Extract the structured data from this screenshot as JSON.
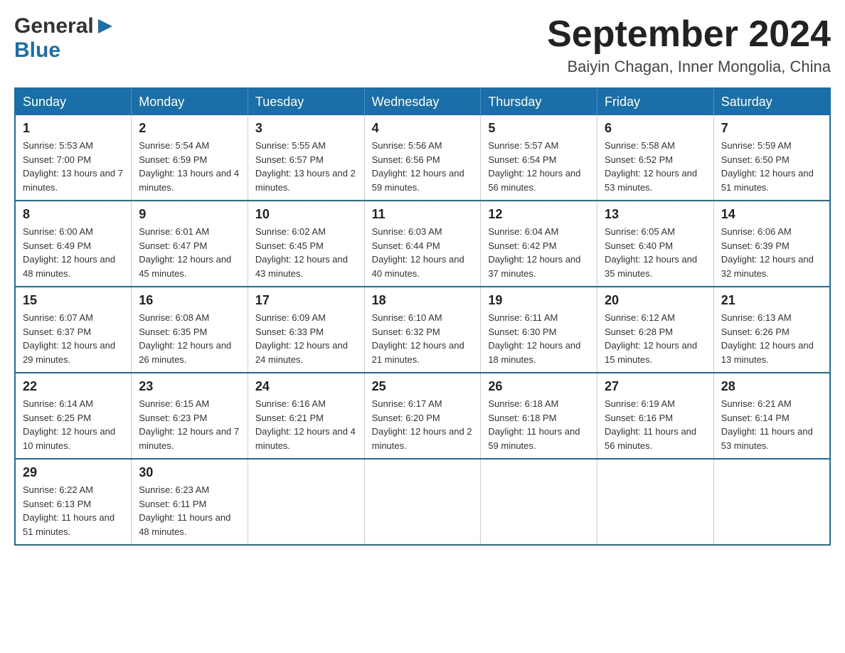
{
  "header": {
    "logo_general": "General",
    "logo_blue": "Blue",
    "month_title": "September 2024",
    "location": "Baiyin Chagan, Inner Mongolia, China"
  },
  "weekdays": [
    "Sunday",
    "Monday",
    "Tuesday",
    "Wednesday",
    "Thursday",
    "Friday",
    "Saturday"
  ],
  "weeks": [
    [
      {
        "day": "1",
        "sunrise": "Sunrise: 5:53 AM",
        "sunset": "Sunset: 7:00 PM",
        "daylight": "Daylight: 13 hours and 7 minutes."
      },
      {
        "day": "2",
        "sunrise": "Sunrise: 5:54 AM",
        "sunset": "Sunset: 6:59 PM",
        "daylight": "Daylight: 13 hours and 4 minutes."
      },
      {
        "day": "3",
        "sunrise": "Sunrise: 5:55 AM",
        "sunset": "Sunset: 6:57 PM",
        "daylight": "Daylight: 13 hours and 2 minutes."
      },
      {
        "day": "4",
        "sunrise": "Sunrise: 5:56 AM",
        "sunset": "Sunset: 6:56 PM",
        "daylight": "Daylight: 12 hours and 59 minutes."
      },
      {
        "day": "5",
        "sunrise": "Sunrise: 5:57 AM",
        "sunset": "Sunset: 6:54 PM",
        "daylight": "Daylight: 12 hours and 56 minutes."
      },
      {
        "day": "6",
        "sunrise": "Sunrise: 5:58 AM",
        "sunset": "Sunset: 6:52 PM",
        "daylight": "Daylight: 12 hours and 53 minutes."
      },
      {
        "day": "7",
        "sunrise": "Sunrise: 5:59 AM",
        "sunset": "Sunset: 6:50 PM",
        "daylight": "Daylight: 12 hours and 51 minutes."
      }
    ],
    [
      {
        "day": "8",
        "sunrise": "Sunrise: 6:00 AM",
        "sunset": "Sunset: 6:49 PM",
        "daylight": "Daylight: 12 hours and 48 minutes."
      },
      {
        "day": "9",
        "sunrise": "Sunrise: 6:01 AM",
        "sunset": "Sunset: 6:47 PM",
        "daylight": "Daylight: 12 hours and 45 minutes."
      },
      {
        "day": "10",
        "sunrise": "Sunrise: 6:02 AM",
        "sunset": "Sunset: 6:45 PM",
        "daylight": "Daylight: 12 hours and 43 minutes."
      },
      {
        "day": "11",
        "sunrise": "Sunrise: 6:03 AM",
        "sunset": "Sunset: 6:44 PM",
        "daylight": "Daylight: 12 hours and 40 minutes."
      },
      {
        "day": "12",
        "sunrise": "Sunrise: 6:04 AM",
        "sunset": "Sunset: 6:42 PM",
        "daylight": "Daylight: 12 hours and 37 minutes."
      },
      {
        "day": "13",
        "sunrise": "Sunrise: 6:05 AM",
        "sunset": "Sunset: 6:40 PM",
        "daylight": "Daylight: 12 hours and 35 minutes."
      },
      {
        "day": "14",
        "sunrise": "Sunrise: 6:06 AM",
        "sunset": "Sunset: 6:39 PM",
        "daylight": "Daylight: 12 hours and 32 minutes."
      }
    ],
    [
      {
        "day": "15",
        "sunrise": "Sunrise: 6:07 AM",
        "sunset": "Sunset: 6:37 PM",
        "daylight": "Daylight: 12 hours and 29 minutes."
      },
      {
        "day": "16",
        "sunrise": "Sunrise: 6:08 AM",
        "sunset": "Sunset: 6:35 PM",
        "daylight": "Daylight: 12 hours and 26 minutes."
      },
      {
        "day": "17",
        "sunrise": "Sunrise: 6:09 AM",
        "sunset": "Sunset: 6:33 PM",
        "daylight": "Daylight: 12 hours and 24 minutes."
      },
      {
        "day": "18",
        "sunrise": "Sunrise: 6:10 AM",
        "sunset": "Sunset: 6:32 PM",
        "daylight": "Daylight: 12 hours and 21 minutes."
      },
      {
        "day": "19",
        "sunrise": "Sunrise: 6:11 AM",
        "sunset": "Sunset: 6:30 PM",
        "daylight": "Daylight: 12 hours and 18 minutes."
      },
      {
        "day": "20",
        "sunrise": "Sunrise: 6:12 AM",
        "sunset": "Sunset: 6:28 PM",
        "daylight": "Daylight: 12 hours and 15 minutes."
      },
      {
        "day": "21",
        "sunrise": "Sunrise: 6:13 AM",
        "sunset": "Sunset: 6:26 PM",
        "daylight": "Daylight: 12 hours and 13 minutes."
      }
    ],
    [
      {
        "day": "22",
        "sunrise": "Sunrise: 6:14 AM",
        "sunset": "Sunset: 6:25 PM",
        "daylight": "Daylight: 12 hours and 10 minutes."
      },
      {
        "day": "23",
        "sunrise": "Sunrise: 6:15 AM",
        "sunset": "Sunset: 6:23 PM",
        "daylight": "Daylight: 12 hours and 7 minutes."
      },
      {
        "day": "24",
        "sunrise": "Sunrise: 6:16 AM",
        "sunset": "Sunset: 6:21 PM",
        "daylight": "Daylight: 12 hours and 4 minutes."
      },
      {
        "day": "25",
        "sunrise": "Sunrise: 6:17 AM",
        "sunset": "Sunset: 6:20 PM",
        "daylight": "Daylight: 12 hours and 2 minutes."
      },
      {
        "day": "26",
        "sunrise": "Sunrise: 6:18 AM",
        "sunset": "Sunset: 6:18 PM",
        "daylight": "Daylight: 11 hours and 59 minutes."
      },
      {
        "day": "27",
        "sunrise": "Sunrise: 6:19 AM",
        "sunset": "Sunset: 6:16 PM",
        "daylight": "Daylight: 11 hours and 56 minutes."
      },
      {
        "day": "28",
        "sunrise": "Sunrise: 6:21 AM",
        "sunset": "Sunset: 6:14 PM",
        "daylight": "Daylight: 11 hours and 53 minutes."
      }
    ],
    [
      {
        "day": "29",
        "sunrise": "Sunrise: 6:22 AM",
        "sunset": "Sunset: 6:13 PM",
        "daylight": "Daylight: 11 hours and 51 minutes."
      },
      {
        "day": "30",
        "sunrise": "Sunrise: 6:23 AM",
        "sunset": "Sunset: 6:11 PM",
        "daylight": "Daylight: 11 hours and 48 minutes."
      },
      null,
      null,
      null,
      null,
      null
    ]
  ]
}
